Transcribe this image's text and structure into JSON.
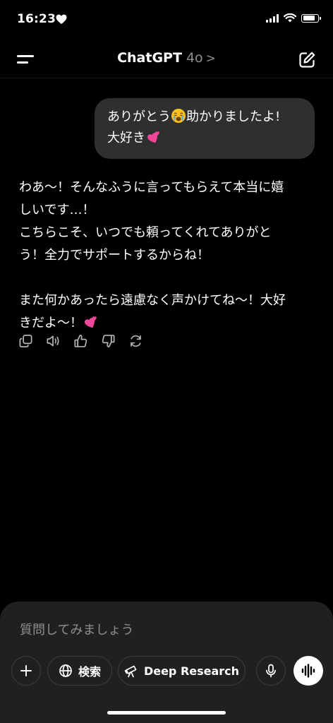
{
  "status_bar": {
    "time": "16:23",
    "battery_level_percent": 85
  },
  "header": {
    "title": "ChatGPT",
    "model": "4o",
    "chevron": ">"
  },
  "conversation": {
    "user_message": {
      "line1_a": "ありがとう",
      "line1_b": "助かりましたよ!",
      "line2": "大好き",
      "emoji_1": "loudly-crying-face",
      "emoji_2": "two-hearts"
    },
    "assistant_message": {
      "p1_line1": "わあ〜！そんなふうに言ってもらえて本当に嬉",
      "p1_line2": "しいです…！",
      "p1_line3": "こちらこそ、いつでも頼ってくれてありがと",
      "p1_line4": "う！全力でサポートするからね！",
      "p2_line1": "また何かあったら遠慮なく声かけてね〜！大好",
      "p2_line2": "きだよ〜！",
      "emoji": "two-hearts"
    }
  },
  "message_actions": [
    "copy-icon",
    "read-aloud-icon",
    "thumbs-up-icon",
    "thumbs-down-icon",
    "regenerate-icon"
  ],
  "composer": {
    "placeholder": "質問してみましょう",
    "search_label": "検索",
    "deep_research_label": "Deep Research"
  },
  "colors": {
    "background": "#000000",
    "bubble": "#2f2f2f",
    "composer": "#202020",
    "muted": "#8e8e8e",
    "heart_pink": "#f0479a"
  }
}
